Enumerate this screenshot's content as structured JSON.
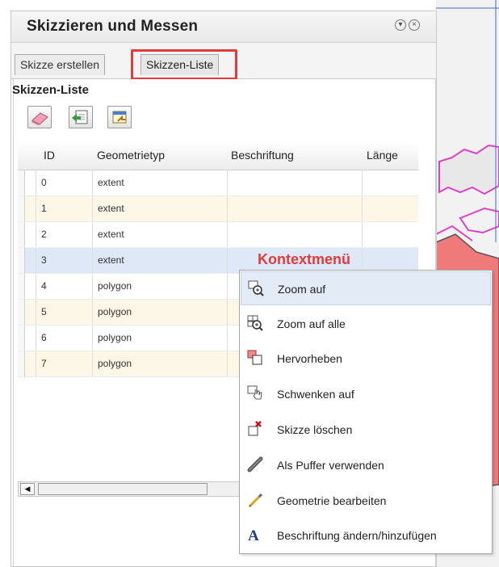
{
  "panel": {
    "title": "Skizzieren und Messen",
    "tabs": [
      {
        "label": "Skizze erstellen",
        "active": false
      },
      {
        "label": "Skizzen-Liste",
        "active": true
      }
    ],
    "section_title": "Skizzen-Liste",
    "toolbar_icons": [
      "eraser-icon",
      "import-sketch-icon",
      "export-sketch-icon"
    ]
  },
  "grid": {
    "columns": [
      "ID",
      "Geometrietyp",
      "Beschriftung",
      "Länge"
    ],
    "rows": [
      {
        "id": "0",
        "type": "extent",
        "label": "",
        "length": ""
      },
      {
        "id": "1",
        "type": "extent",
        "label": "",
        "length": ""
      },
      {
        "id": "2",
        "type": "extent",
        "label": "",
        "length": ""
      },
      {
        "id": "3",
        "type": "extent",
        "label": "",
        "length": ""
      },
      {
        "id": "4",
        "type": "polygon",
        "label": "",
        "length": ""
      },
      {
        "id": "5",
        "type": "polygon",
        "label": "",
        "length": ""
      },
      {
        "id": "6",
        "type": "polygon",
        "label": "",
        "length": ""
      },
      {
        "id": "7",
        "type": "polygon",
        "label": "",
        "length": ""
      }
    ],
    "selected_row": "3"
  },
  "context_menu": {
    "caption": "Kontextmenü",
    "items": [
      {
        "label": "Zoom auf",
        "icon": "zoom-to-icon"
      },
      {
        "label": "Zoom auf alle",
        "icon": "zoom-to-all-icon"
      },
      {
        "label": "Hervorheben",
        "icon": "highlight-icon"
      },
      {
        "label": "Schwenken auf",
        "icon": "pan-to-icon"
      },
      {
        "label": "Skizze löschen",
        "icon": "delete-sketch-icon"
      },
      {
        "label": "Als Puffer verwenden",
        "icon": "buffer-icon"
      },
      {
        "label": "Geometrie bearbeiten",
        "icon": "edit-geometry-icon"
      },
      {
        "label": "Beschriftung ändern/hinzufügen",
        "icon": "label-text-icon"
      }
    ],
    "highlighted": "Zoom auf"
  },
  "colors": {
    "annotation_red": "#e23b3b",
    "row_alt": "#fcf7e7",
    "row_selected": "#dfe8f6",
    "menu_highlight": "#e3ebf6"
  }
}
